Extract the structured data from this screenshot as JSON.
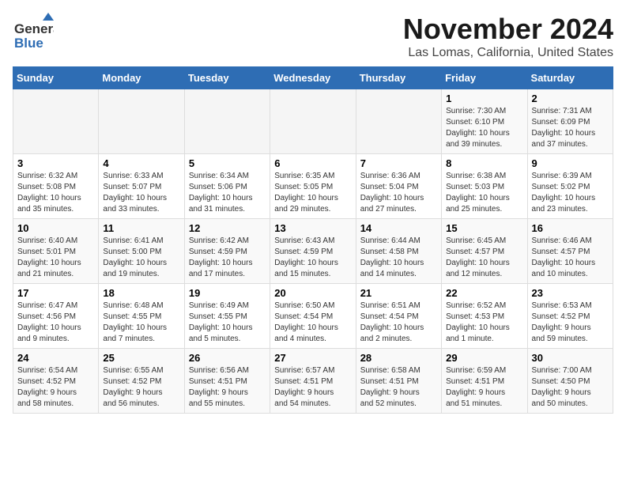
{
  "header": {
    "logo_line1": "General",
    "logo_line2": "Blue",
    "title": "November 2024",
    "subtitle": "Las Lomas, California, United States"
  },
  "weekdays": [
    "Sunday",
    "Monday",
    "Tuesday",
    "Wednesday",
    "Thursday",
    "Friday",
    "Saturday"
  ],
  "weeks": [
    [
      {
        "day": "",
        "detail": ""
      },
      {
        "day": "",
        "detail": ""
      },
      {
        "day": "",
        "detail": ""
      },
      {
        "day": "",
        "detail": ""
      },
      {
        "day": "",
        "detail": ""
      },
      {
        "day": "1",
        "detail": "Sunrise: 7:30 AM\nSunset: 6:10 PM\nDaylight: 10 hours\nand 39 minutes."
      },
      {
        "day": "2",
        "detail": "Sunrise: 7:31 AM\nSunset: 6:09 PM\nDaylight: 10 hours\nand 37 minutes."
      }
    ],
    [
      {
        "day": "3",
        "detail": "Sunrise: 6:32 AM\nSunset: 5:08 PM\nDaylight: 10 hours\nand 35 minutes."
      },
      {
        "day": "4",
        "detail": "Sunrise: 6:33 AM\nSunset: 5:07 PM\nDaylight: 10 hours\nand 33 minutes."
      },
      {
        "day": "5",
        "detail": "Sunrise: 6:34 AM\nSunset: 5:06 PM\nDaylight: 10 hours\nand 31 minutes."
      },
      {
        "day": "6",
        "detail": "Sunrise: 6:35 AM\nSunset: 5:05 PM\nDaylight: 10 hours\nand 29 minutes."
      },
      {
        "day": "7",
        "detail": "Sunrise: 6:36 AM\nSunset: 5:04 PM\nDaylight: 10 hours\nand 27 minutes."
      },
      {
        "day": "8",
        "detail": "Sunrise: 6:38 AM\nSunset: 5:03 PM\nDaylight: 10 hours\nand 25 minutes."
      },
      {
        "day": "9",
        "detail": "Sunrise: 6:39 AM\nSunset: 5:02 PM\nDaylight: 10 hours\nand 23 minutes."
      }
    ],
    [
      {
        "day": "10",
        "detail": "Sunrise: 6:40 AM\nSunset: 5:01 PM\nDaylight: 10 hours\nand 21 minutes."
      },
      {
        "day": "11",
        "detail": "Sunrise: 6:41 AM\nSunset: 5:00 PM\nDaylight: 10 hours\nand 19 minutes."
      },
      {
        "day": "12",
        "detail": "Sunrise: 6:42 AM\nSunset: 4:59 PM\nDaylight: 10 hours\nand 17 minutes."
      },
      {
        "day": "13",
        "detail": "Sunrise: 6:43 AM\nSunset: 4:59 PM\nDaylight: 10 hours\nand 15 minutes."
      },
      {
        "day": "14",
        "detail": "Sunrise: 6:44 AM\nSunset: 4:58 PM\nDaylight: 10 hours\nand 14 minutes."
      },
      {
        "day": "15",
        "detail": "Sunrise: 6:45 AM\nSunset: 4:57 PM\nDaylight: 10 hours\nand 12 minutes."
      },
      {
        "day": "16",
        "detail": "Sunrise: 6:46 AM\nSunset: 4:57 PM\nDaylight: 10 hours\nand 10 minutes."
      }
    ],
    [
      {
        "day": "17",
        "detail": "Sunrise: 6:47 AM\nSunset: 4:56 PM\nDaylight: 10 hours\nand 9 minutes."
      },
      {
        "day": "18",
        "detail": "Sunrise: 6:48 AM\nSunset: 4:55 PM\nDaylight: 10 hours\nand 7 minutes."
      },
      {
        "day": "19",
        "detail": "Sunrise: 6:49 AM\nSunset: 4:55 PM\nDaylight: 10 hours\nand 5 minutes."
      },
      {
        "day": "20",
        "detail": "Sunrise: 6:50 AM\nSunset: 4:54 PM\nDaylight: 10 hours\nand 4 minutes."
      },
      {
        "day": "21",
        "detail": "Sunrise: 6:51 AM\nSunset: 4:54 PM\nDaylight: 10 hours\nand 2 minutes."
      },
      {
        "day": "22",
        "detail": "Sunrise: 6:52 AM\nSunset: 4:53 PM\nDaylight: 10 hours\nand 1 minute."
      },
      {
        "day": "23",
        "detail": "Sunrise: 6:53 AM\nSunset: 4:52 PM\nDaylight: 9 hours\nand 59 minutes."
      }
    ],
    [
      {
        "day": "24",
        "detail": "Sunrise: 6:54 AM\nSunset: 4:52 PM\nDaylight: 9 hours\nand 58 minutes."
      },
      {
        "day": "25",
        "detail": "Sunrise: 6:55 AM\nSunset: 4:52 PM\nDaylight: 9 hours\nand 56 minutes."
      },
      {
        "day": "26",
        "detail": "Sunrise: 6:56 AM\nSunset: 4:51 PM\nDaylight: 9 hours\nand 55 minutes."
      },
      {
        "day": "27",
        "detail": "Sunrise: 6:57 AM\nSunset: 4:51 PM\nDaylight: 9 hours\nand 54 minutes."
      },
      {
        "day": "28",
        "detail": "Sunrise: 6:58 AM\nSunset: 4:51 PM\nDaylight: 9 hours\nand 52 minutes."
      },
      {
        "day": "29",
        "detail": "Sunrise: 6:59 AM\nSunset: 4:51 PM\nDaylight: 9 hours\nand 51 minutes."
      },
      {
        "day": "30",
        "detail": "Sunrise: 7:00 AM\nSunset: 4:50 PM\nDaylight: 9 hours\nand 50 minutes."
      }
    ]
  ]
}
